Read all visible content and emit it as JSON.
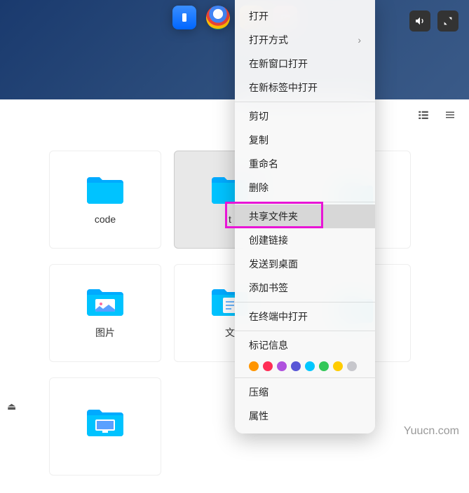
{
  "dock": {
    "items": [
      "app",
      "chrome",
      "store",
      "photos"
    ]
  },
  "topbar": {
    "sound": "sound",
    "fullscreen": "fullscreen"
  },
  "sidebar": {
    "home": "home"
  },
  "toolbar": {
    "view_list": "list-view",
    "menu": "menu"
  },
  "folders": [
    {
      "label": "code",
      "type": "plain"
    },
    {
      "label": "t",
      "type": "plain",
      "selected": true
    },
    {
      "label": "",
      "type": "plain"
    },
    {
      "label": "图片",
      "type": "pictures"
    },
    {
      "label": "文",
      "type": "documents"
    },
    {
      "label": "",
      "type": "plain"
    },
    {
      "label": "",
      "type": "desktop"
    }
  ],
  "context_menu": {
    "groups": [
      [
        {
          "label": "打开",
          "submenu": false
        },
        {
          "label": "打开方式",
          "submenu": true
        },
        {
          "label": "在新窗口打开",
          "submenu": false
        },
        {
          "label": "在新标签中打开",
          "submenu": false
        }
      ],
      [
        {
          "label": "剪切",
          "submenu": false
        },
        {
          "label": "复制",
          "submenu": false
        },
        {
          "label": "重命名",
          "submenu": false
        },
        {
          "label": "删除",
          "submenu": false
        }
      ],
      [
        {
          "label": "共享文件夹",
          "submenu": false,
          "highlighted": true,
          "boxed": true
        },
        {
          "label": "创建链接",
          "submenu": false
        },
        {
          "label": "发送到桌面",
          "submenu": false
        },
        {
          "label": "添加书签",
          "submenu": false
        }
      ],
      [
        {
          "label": "在终端中打开",
          "submenu": false
        }
      ],
      [
        {
          "label": "标记信息",
          "submenu": false
        }
      ],
      [
        {
          "label": "压缩",
          "submenu": false
        },
        {
          "label": "属性",
          "submenu": false
        }
      ]
    ],
    "tag_colors": [
      "#ff9500",
      "#ff2d55",
      "#af52de",
      "#5856d6",
      "#00c7ff",
      "#34c759",
      "#ffcc00",
      "#c7c7cc"
    ]
  },
  "watermark": "Yuucn.com",
  "chevron": "›"
}
